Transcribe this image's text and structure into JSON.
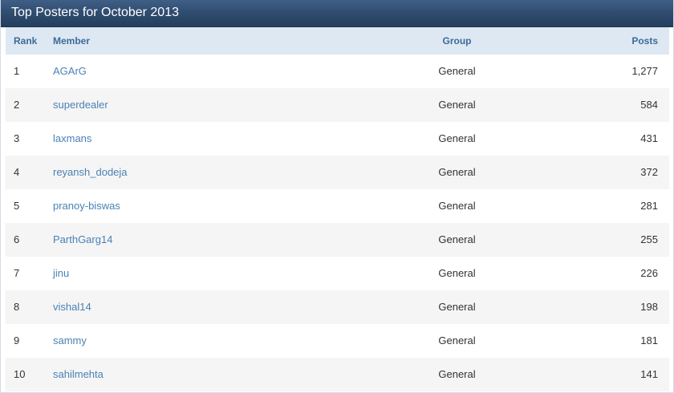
{
  "panel": {
    "title": "Top Posters for October 2013"
  },
  "table": {
    "headers": {
      "rank": "Rank",
      "member": "Member",
      "group": "Group",
      "posts": "Posts"
    },
    "rows": [
      {
        "rank": "1",
        "member": "AGArG",
        "group": "General",
        "posts": "1,277"
      },
      {
        "rank": "2",
        "member": "superdealer",
        "group": "General",
        "posts": "584"
      },
      {
        "rank": "3",
        "member": "laxmans",
        "group": "General",
        "posts": "431"
      },
      {
        "rank": "4",
        "member": "reyansh_dodeja",
        "group": "General",
        "posts": "372"
      },
      {
        "rank": "5",
        "member": "pranoy-biswas",
        "group": "General",
        "posts": "281"
      },
      {
        "rank": "6",
        "member": "ParthGarg14",
        "group": "General",
        "posts": "255"
      },
      {
        "rank": "7",
        "member": "jinu",
        "group": "General",
        "posts": "226"
      },
      {
        "rank": "8",
        "member": "vishal14",
        "group": "General",
        "posts": "198"
      },
      {
        "rank": "9",
        "member": "sammy",
        "group": "General",
        "posts": "181"
      },
      {
        "rank": "10",
        "member": "sahilmehta",
        "group": "General",
        "posts": "141"
      }
    ]
  },
  "colors": {
    "title_bar": "#2e4a6d",
    "header_bg": "#dde8f3",
    "header_text": "#3d6b98",
    "link": "#4a82b5",
    "row_alt": "#f5f5f5"
  }
}
